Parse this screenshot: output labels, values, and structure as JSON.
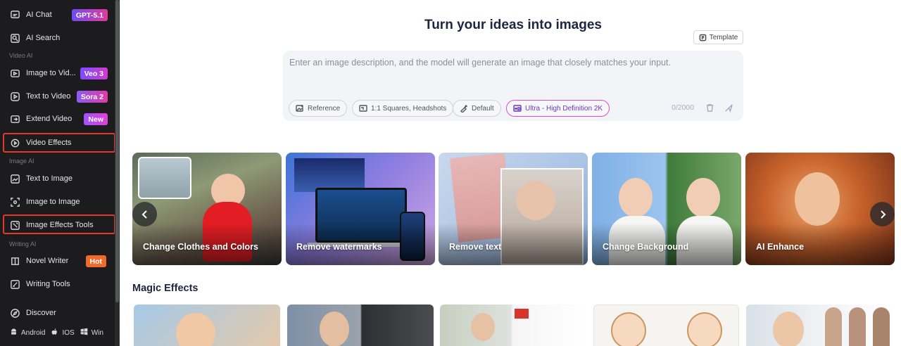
{
  "sidebar": {
    "items": [
      {
        "label": "AI Chat",
        "icon": "chat-icon",
        "badge": "GPT-5.1"
      },
      {
        "label": "AI Search",
        "icon": "search-icon"
      },
      {
        "label": "Image to Vid...",
        "icon": "image-video-icon",
        "badge": "Veo 3"
      },
      {
        "label": "Text to Video",
        "icon": "play-icon",
        "badge": "Sora 2"
      },
      {
        "label": "Extend Video",
        "icon": "extend-icon",
        "badge": "New"
      },
      {
        "label": "Video Effects",
        "icon": "effects-icon"
      },
      {
        "label": "Text to Image",
        "icon": "text-image-icon"
      },
      {
        "label": "Image to Image",
        "icon": "image-image-icon"
      },
      {
        "label": "Image Effects Tools",
        "icon": "image-tools-icon"
      },
      {
        "label": "Novel Writer",
        "icon": "book-icon",
        "badge": "Hot"
      },
      {
        "label": "Writing Tools",
        "icon": "pen-icon"
      },
      {
        "label": "Discover",
        "icon": "compass-icon"
      }
    ],
    "sections": {
      "video": "Video AI",
      "image": "Image AI",
      "writing": "Writing AI"
    },
    "platforms": [
      "Android",
      "IOS",
      "Win"
    ]
  },
  "main": {
    "title": "Turn your ideas into images",
    "template_label": "Template",
    "prompt_placeholder": "Enter an image description, and the model will generate an image that closely matches your input.",
    "chips": [
      "Reference",
      "1:1 Squares, Headshots",
      "Default",
      "Ultra - High Definition 2K"
    ],
    "counter": "0/2000",
    "cards": [
      "Change Clothes and Colors",
      "Remove watermarks",
      "Remove text",
      "Change Background",
      "AI Enhance"
    ],
    "magic_title": "Magic Effects"
  },
  "colors": {
    "sidebar_bg": "#1c1c1e",
    "highlight": "#e23a2a",
    "title": "#1e2540"
  }
}
